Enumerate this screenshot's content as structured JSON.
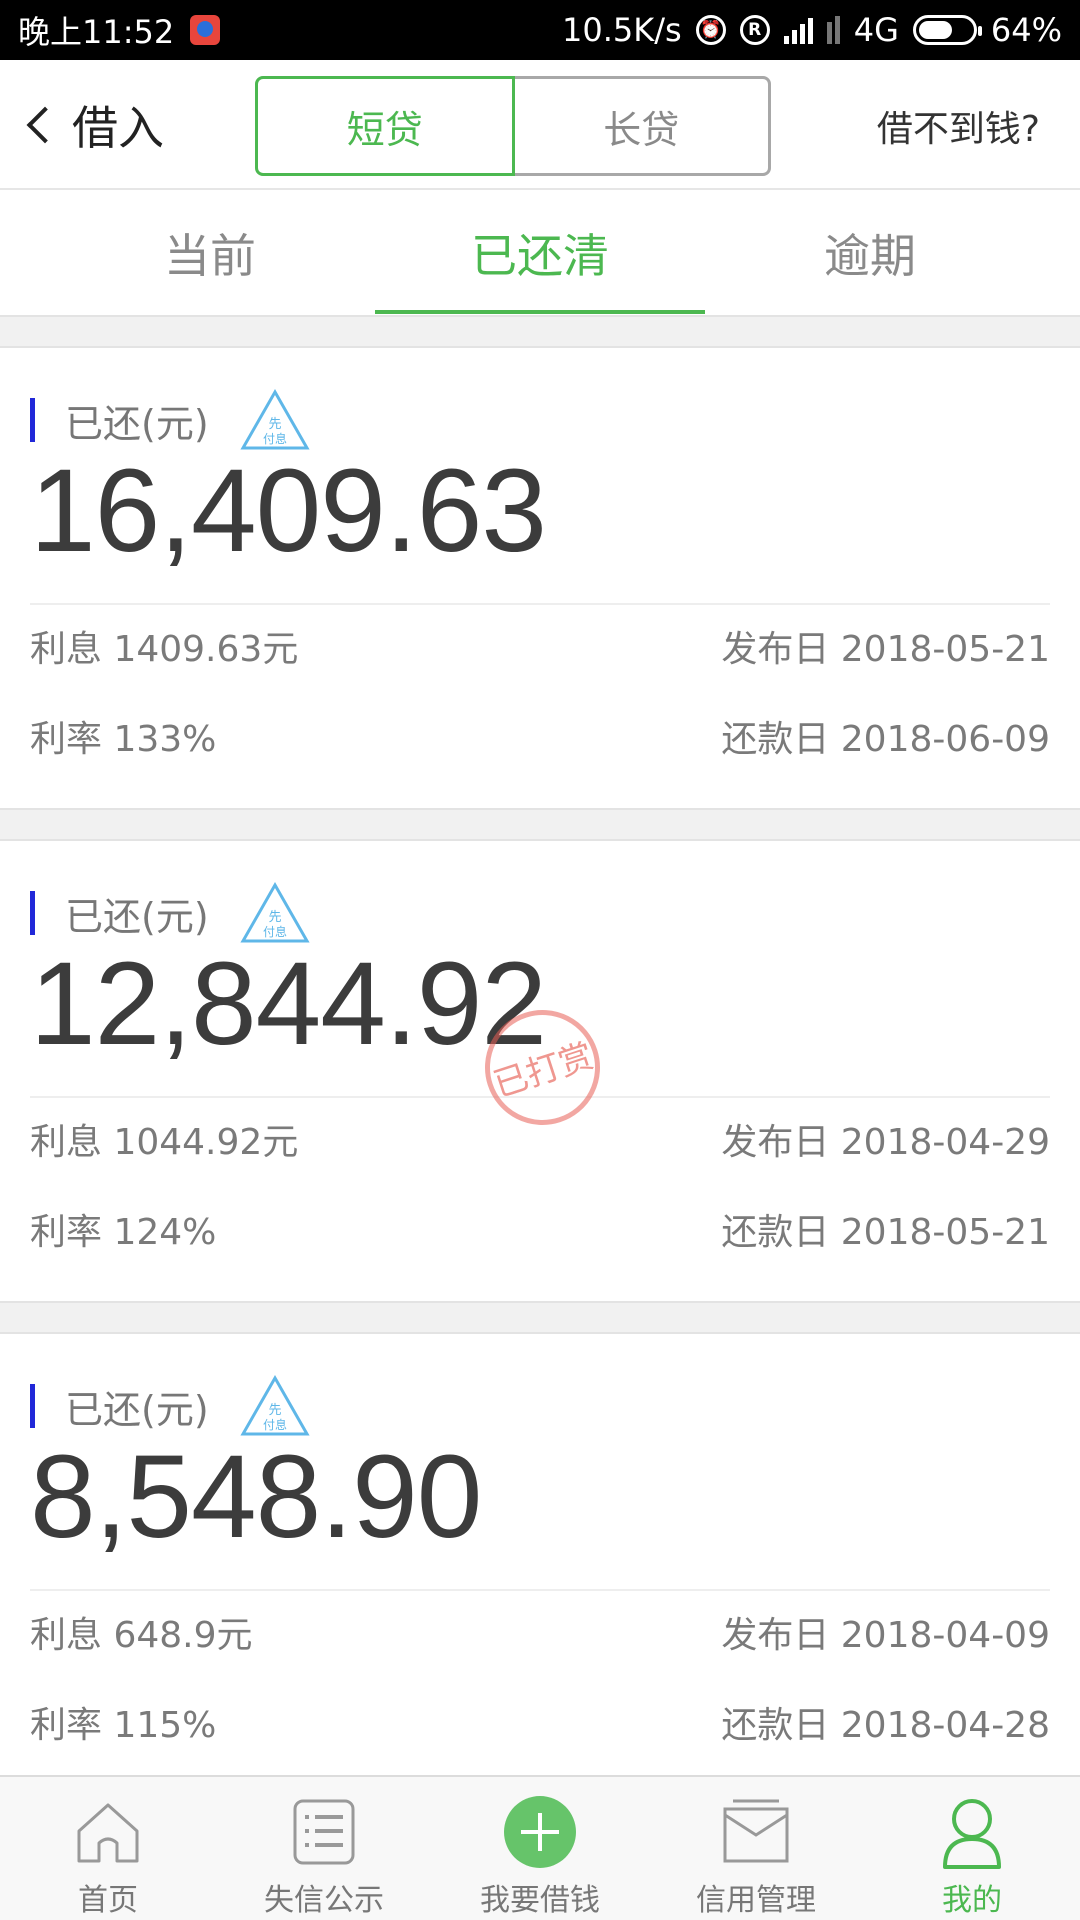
{
  "status_bar": {
    "time": "晚上11:52",
    "speed": "10.5K/s",
    "network": "4G",
    "battery": "64%",
    "battery_level": 0.64
  },
  "header": {
    "title": "借入",
    "segments": [
      "短贷",
      "长贷"
    ],
    "active_segment": "短贷",
    "help_link": "借不到钱?"
  },
  "tabs": {
    "items": [
      "当前",
      "已还清",
      "逾期"
    ],
    "active": "已还清"
  },
  "cards": [
    {
      "label": "已还(元)",
      "badge": "先付息",
      "amount": "16,409.63",
      "interest": "利息 1409.63元",
      "publish_date": "发布日 2018-05-21",
      "rate": "利率 133%",
      "repay_date": "还款日 2018-06-09"
    },
    {
      "label": "已还(元)",
      "badge": "先付息",
      "amount": "12,844.92",
      "interest": "利息 1044.92元",
      "publish_date": "发布日 2018-04-29",
      "rate": "利率 124%",
      "repay_date": "还款日 2018-05-21",
      "stamp": "已打赏"
    },
    {
      "label": "已还(元)",
      "badge": "先付息",
      "amount": "8,548.90",
      "interest": "利息 648.9元",
      "publish_date": "发布日 2018-04-09",
      "rate": "利率 115%",
      "repay_date": "还款日 2018-04-28"
    }
  ],
  "bottom_nav": {
    "items": [
      {
        "label": "首页",
        "icon": "home-icon"
      },
      {
        "label": "失信公示",
        "icon": "list-icon"
      },
      {
        "label": "我要借钱",
        "icon": "plus-circle-icon"
      },
      {
        "label": "信用管理",
        "icon": "tray-icon"
      },
      {
        "label": "我的",
        "icon": "person-icon"
      }
    ],
    "active": "我的"
  },
  "colors": {
    "accent_green": "#4cb850",
    "amount_text": "#3c3c3c",
    "label_bar_blue": "#2128d8",
    "stamp_red": "#e75f55"
  }
}
